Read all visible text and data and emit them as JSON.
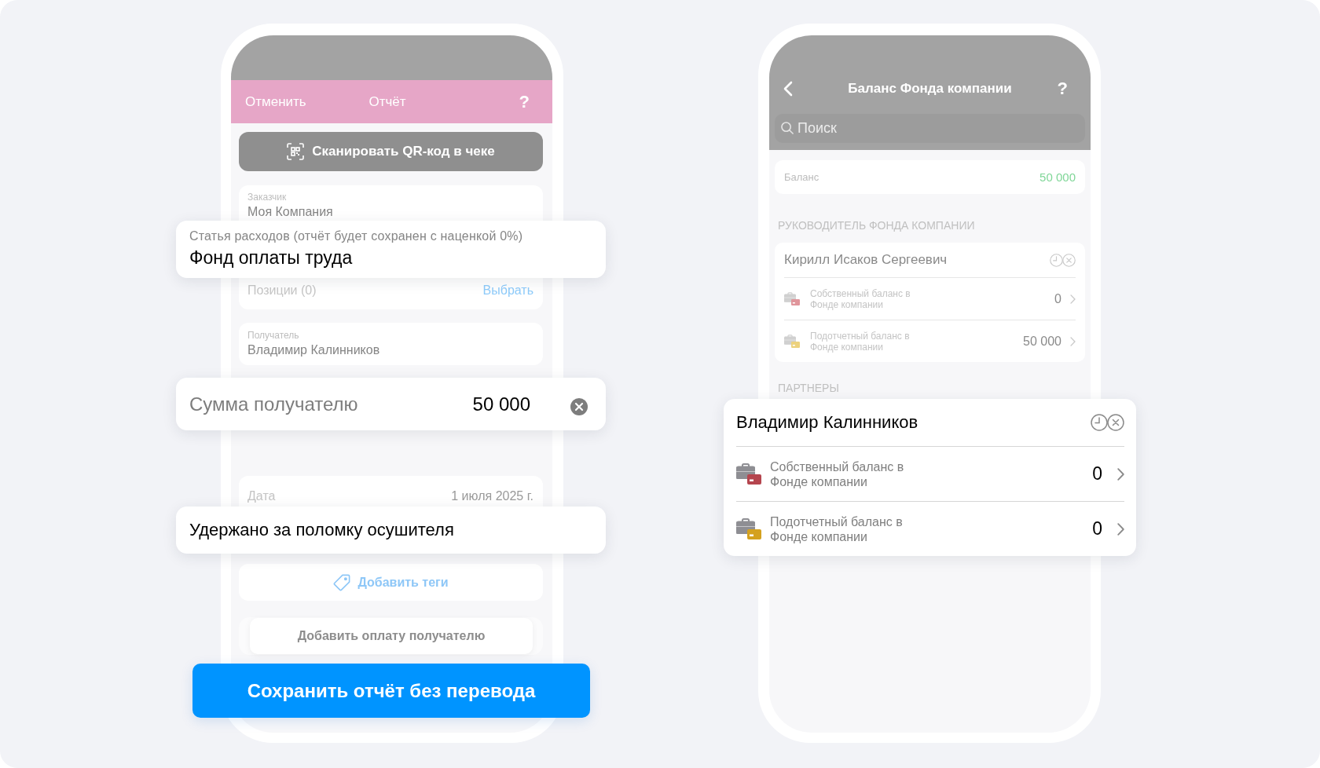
{
  "report_screen": {
    "header": {
      "cancel": "Отменить",
      "title": "Отчёт",
      "help": "?"
    },
    "scan_button": "Сканировать QR-код в чеке",
    "customer": {
      "label": "Заказчик",
      "value": "Моя Компания"
    },
    "expense_item": {
      "label": "Статья расходов (отчёт будет сохранен с наценкой 0%)",
      "value": "Фонд оплаты труда"
    },
    "positions": {
      "label": "Позиции (0)",
      "action": "Выбрать"
    },
    "recipient": {
      "label": "Получатель",
      "value": "Владимир Калинников"
    },
    "amount": {
      "label": "Сумма получателю",
      "value": "50 000"
    },
    "date": {
      "label": "Дата",
      "value": "1 июля 2025 г."
    },
    "comment": "Удержано за поломку осушителя",
    "add_tags": "Добавить теги",
    "add_payment": "Добавить оплату получателю",
    "save_button": "Сохранить отчёт без перевода"
  },
  "fund_screen": {
    "header": {
      "title": "Баланс Фонда компании",
      "help": "?"
    },
    "search": {
      "placeholder": "Поиск"
    },
    "balance": {
      "label": "Баланс",
      "value": "50 000"
    },
    "sections": [
      {
        "title": "РУКОВОДИТЕЛЬ ФОНДА КОМПАНИИ",
        "people": [
          {
            "name": "Кирилл Исаков Сергеевич",
            "highlighted": false,
            "balances": [
              {
                "label": "Собственный баланс в Фонде компании",
                "value": "0",
                "color": "#e0959b"
              },
              {
                "label": "Подотчетный баланс в Фонде компании",
                "value": "50 000",
                "color": "#ecd27e"
              }
            ]
          }
        ]
      },
      {
        "title": "ПАРТНЕРЫ",
        "people": [
          {
            "name": "Владимир Калинников",
            "highlighted": true,
            "balances": [
              {
                "label": "Собственный баланс в Фонде компании",
                "value": "0",
                "color": "#b5454e"
              },
              {
                "label": "Подотчетный баланс в Фонде компании",
                "value": "0",
                "color": "#d4a11e"
              }
            ]
          }
        ]
      }
    ]
  }
}
